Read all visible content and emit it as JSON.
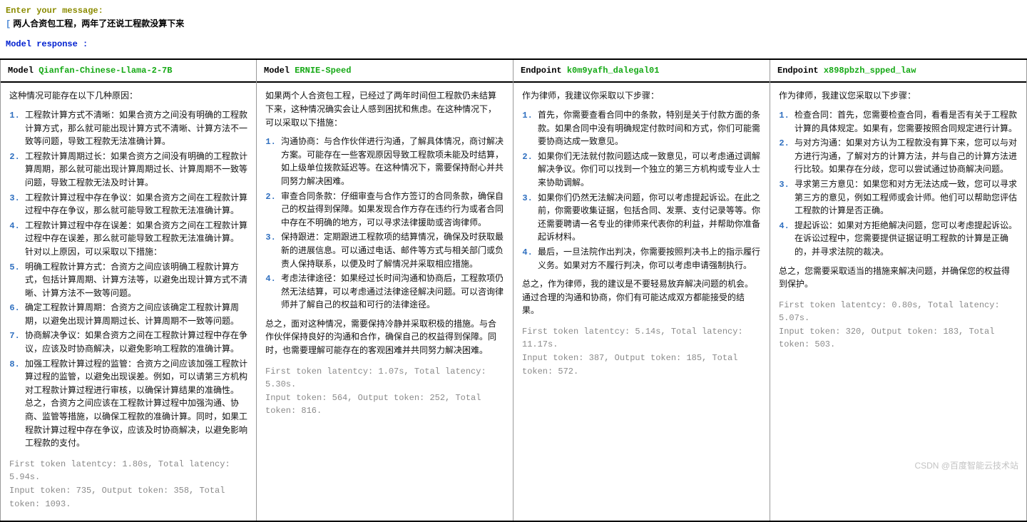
{
  "prompt": {
    "label": "Enter your message:",
    "cursor": "[",
    "user_text": "两人合资包工程，两年了还说工程款没算下来"
  },
  "response_label": "Model response :",
  "columns": [
    {
      "header_prefix": "Model",
      "header_name": "Qianfan-Chinese-Llama-2-7B",
      "intro": "这种情况可能存在以下几种原因：",
      "items": [
        "工程款计算方式不清晰：如果合资方之间没有明确的工程款计算方式，那么就可能出现计算方式不清晰、计算方法不一致等问题，导致工程款无法准确计算。",
        "工程款计算周期过长：如果合资方之间没有明确的工程款计算周期，那么就可能出现计算周期过长、计算周期不一致等问题，导致工程款无法及时计算。",
        "工程款计算过程中存在争议：如果合资方之间在工程款计算过程中存在争议，那么就可能导致工程款无法准确计算。",
        "工程款计算过程中存在误差：如果合资方之间在工程款计算过程中存在误差，那么就可能导致工程款无法准确计算。\n针对以上原因，可以采取以下措施：",
        "明确工程款计算方式：合资方之间应该明确工程款计算方式，包括计算周期、计算方法等，以避免出现计算方式不清晰、计算方法不一致等问题。",
        "确定工程款计算周期：合资方之间应该确定工程款计算周期，以避免出现计算周期过长、计算周期不一致等问题。",
        "协商解决争议：如果合资方之间在工程款计算过程中存在争议，应该及时协商解决，以避免影响工程款的准确计算。",
        "加强工程款计算过程的监管：合资方之间应该加强工程款计算过程的监管，以避免出现误差。例如，可以请第三方机构对工程款计算过程进行审核，以确保计算结果的准确性。\n总之，合资方之间应该在工程款计算过程中加强沟通、协商、监管等措施，以确保工程款的准确计算。同时，如果工程款计算过程中存在争议，应该及时协商解决，以避免影响工程款的支付。"
      ],
      "conclusion": "",
      "metrics": "First token latentcy: 1.80s, Total latency: 5.94s.\nInput token: 735, Output token: 358, Total token: 1093."
    },
    {
      "header_prefix": "Model",
      "header_name": "ERNIE-Speed",
      "intro": "如果两个人合资包工程，已经过了两年时间但工程款仍未结算下来，这种情况确实会让人感到困扰和焦虑。在这种情况下，可以采取以下措施：",
      "items": [
        "沟通协商：与合作伙伴进行沟通，了解具体情况，商讨解决方案。可能存在一些客观原因导致工程款项未能及时结算，如上级单位拨款延迟等。在这种情况下，需要保持耐心并共同努力解决困难。",
        "审查合同条款：仔细审查与合作方签订的合同条款，确保自己的权益得到保障。如果发现合作方存在违约行为或者合同中存在不明确的地方，可以寻求法律援助或咨询律师。",
        "保持跟进：定期跟进工程款项的结算情况，确保及时获取最新的进展信息。可以通过电话、邮件等方式与相关部门或负责人保持联系，以便及时了解情况并采取相应措施。",
        "考虑法律途径：如果经过长时间沟通和协商后，工程款项仍然无法结算，可以考虑通过法律途径解决问题。可以咨询律师并了解自己的权益和可行的法律途径。"
      ],
      "conclusion": "总之，面对这种情况，需要保持冷静并采取积极的措施。与合作伙伴保持良好的沟通和合作，确保自己的权益得到保障。同时，也需要理解可能存在的客观困难并共同努力解决困难。",
      "metrics": "First token latentcy: 1.07s, Total latency: 5.30s.\nInput token: 564, Output token: 252, Total token: 816."
    },
    {
      "header_prefix": "Endpoint",
      "header_name": "k0m9yafh_dalegal01",
      "intro": "作为律师，我建议你采取以下步骤：",
      "items": [
        "首先，你需要查看合同中的条款，特别是关于付款方面的条款。如果合同中没有明确规定付款时间和方式，你们可能需要协商达成一致意见。",
        "如果你们无法就付款问题达成一致意见，可以考虑通过调解解决争议。你们可以找到一个独立的第三方机构或专业人士来协助调解。",
        "如果你们仍然无法解决问题，你可以考虑提起诉讼。在此之前，你需要收集证据，包括合同、发票、支付记录等等。你还需要聘请一名专业的律师来代表你的利益，并帮助你准备起诉材料。",
        "最后，一旦法院作出判决，你需要按照判决书上的指示履行义务。如果对方不履行判决，你可以考虑申请强制执行。"
      ],
      "conclusion": "总之，作为律师，我的建议是不要轻易放弃解决问题的机会。通过合理的沟通和协商，你们有可能达成双方都能接受的结果。",
      "metrics": "First token latentcy: 5.14s, Total latency: 11.17s.\nInput token: 387, Output token: 185, Total token: 572."
    },
    {
      "header_prefix": "Endpoint",
      "header_name": "x898pbzh_spped_law",
      "intro": "作为律师，我建议您采取以下步骤：",
      "items": [
        "检查合同：首先，您需要检查合同，看看是否有关于工程款计算的具体规定。如果有，您需要按照合同规定进行计算。",
        "与对方沟通：如果对方认为工程款没有算下来，您可以与对方进行沟通，了解对方的计算方法，并与自己的计算方法进行比较。如果存在分歧，您可以尝试通过协商解决问题。",
        "寻求第三方意见：如果您和对方无法达成一致，您可以寻求第三方的意见，例如工程师或会计师。他们可以帮助您评估工程款的计算是否正确。",
        "提起诉讼：如果对方拒绝解决问题，您可以考虑提起诉讼。在诉讼过程中，您需要提供证据证明工程款的计算是正确的，并寻求法院的裁决。"
      ],
      "conclusion": "总之，您需要采取适当的措施来解决问题，并确保您的权益得到保护。",
      "metrics": "First token latentcy: 0.80s, Total latency: 5.07s.\nInput token: 320, Output token: 183, Total token: 503."
    }
  ],
  "watermark": "CSDN @百度智能云技术站"
}
